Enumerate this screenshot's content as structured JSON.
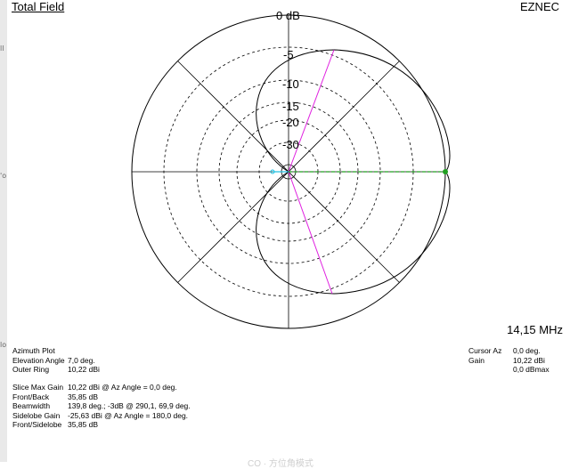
{
  "header": {
    "title": "Total Field",
    "brand": "EZNEC"
  },
  "edge_glyphs": [
    "ll",
    "'o",
    "lo"
  ],
  "plot": {
    "rings": [
      {
        "label": "0 dB",
        "value": 0
      },
      {
        "label": "-5",
        "value": -5
      },
      {
        "label": "-10",
        "value": -10
      },
      {
        "label": "-15",
        "value": -15
      },
      {
        "label": "-20",
        "value": -20
      },
      {
        "label": "-30",
        "value": -30
      }
    ],
    "colors": {
      "beam": "#e020e0",
      "cursor": "#20a020",
      "back": "#20c0e0",
      "pattern": "#000000",
      "grid": "#000000"
    }
  },
  "frequency": "14,15 MHz",
  "info_left_a": [
    {
      "label": "Azimuth Plot",
      "value": ""
    },
    {
      "label": "Elevation Angle",
      "value": "7,0 deg."
    },
    {
      "label": "Outer Ring",
      "value": "10,22 dBi"
    }
  ],
  "info_left_b": [
    {
      "label": "Slice Max Gain",
      "value": "10,22 dBi @ Az Angle = 0,0 deg."
    },
    {
      "label": "Front/Back",
      "value": "35,85 dB"
    },
    {
      "label": "Beamwidth",
      "value": "139,8 deg.; -3dB @ 290,1, 69,9 deg."
    },
    {
      "label": "Sidelobe Gain",
      "value": "-25,63 dBi @ Az Angle = 180,0 deg."
    },
    {
      "label": "Front/Sidelobe",
      "value": "35,85 dB"
    }
  ],
  "info_right": [
    {
      "label": "Cursor Az",
      "value": "0,0 deg."
    },
    {
      "label": "Gain",
      "value": "10,22 dBi"
    },
    {
      "label": "",
      "value": "0,0 dBmax"
    }
  ],
  "footer_ghost": "CO · 方位角模式"
}
